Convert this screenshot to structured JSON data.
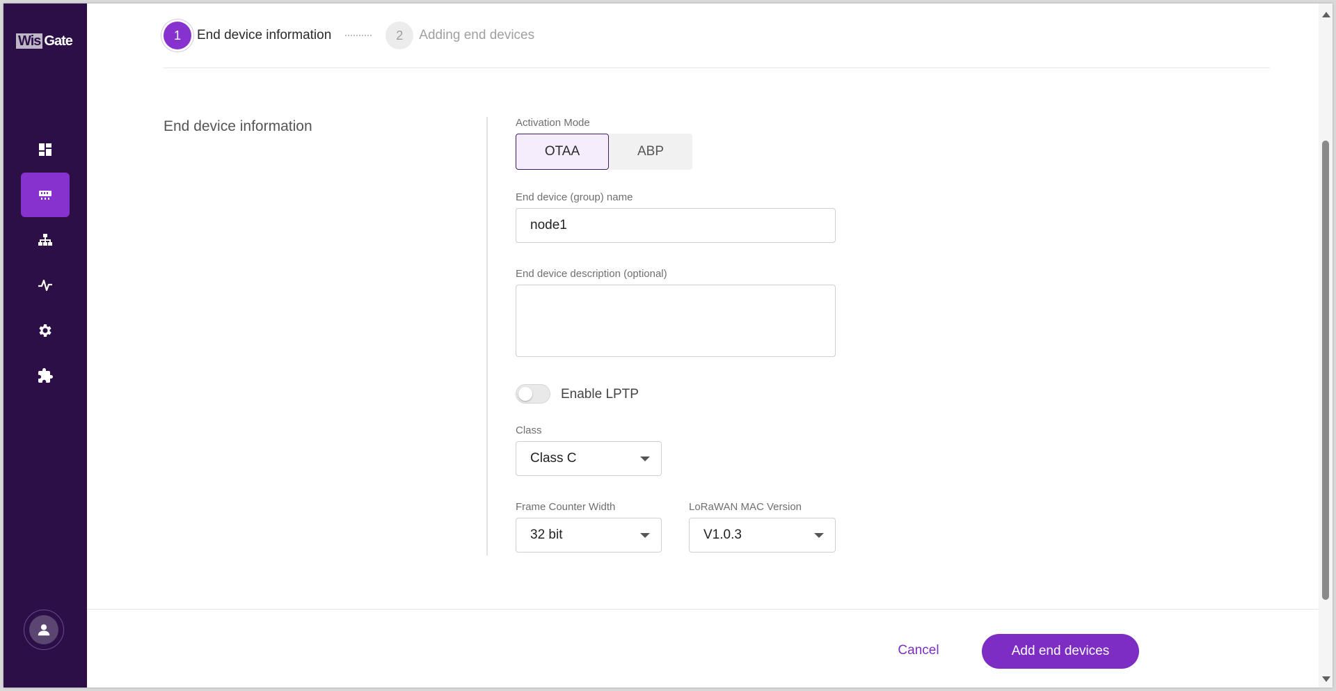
{
  "brand": {
    "logo_part1": "Wis",
    "logo_part2": "Gate"
  },
  "sidebar": {
    "items": [
      {
        "name": "dashboard-icon",
        "active": false
      },
      {
        "name": "end-devices-icon",
        "active": true
      },
      {
        "name": "network-icon",
        "active": false
      },
      {
        "name": "activity-icon",
        "active": false
      },
      {
        "name": "settings-icon",
        "active": false
      },
      {
        "name": "extensions-icon",
        "active": false
      }
    ],
    "user_icon": "user-icon"
  },
  "stepper": {
    "steps": [
      {
        "number": "1",
        "label": "End device information",
        "state": "active"
      },
      {
        "number": "2",
        "label": "Adding end devices",
        "state": "inactive"
      }
    ]
  },
  "section": {
    "title": "End device information"
  },
  "form": {
    "activation_mode": {
      "label": "Activation Mode",
      "options": [
        "OTAA",
        "ABP"
      ],
      "selected": "OTAA"
    },
    "name": {
      "label": "End device (group) name",
      "value": "node1"
    },
    "description": {
      "label": "End device description (optional)",
      "value": ""
    },
    "lptp": {
      "label": "Enable LPTP",
      "enabled": false
    },
    "class": {
      "label": "Class",
      "value": "Class C"
    },
    "frame_counter_width": {
      "label": "Frame Counter Width",
      "value": "32 bit"
    },
    "mac_version": {
      "label": "LoRaWAN MAC Version",
      "value": "V1.0.3"
    }
  },
  "footer": {
    "cancel_label": "Cancel",
    "submit_label": "Add end devices"
  },
  "colors": {
    "sidebar": "#2d0f48",
    "accent": "#8731cf",
    "primary_button": "#7d2cc4"
  }
}
